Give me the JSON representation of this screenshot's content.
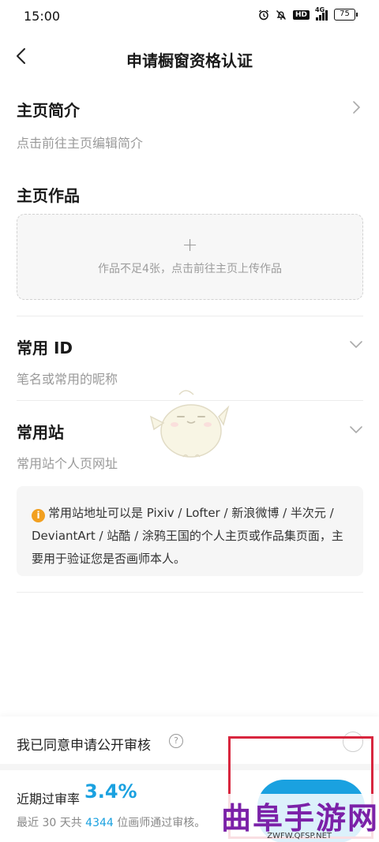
{
  "status_bar": {
    "time": "15:00",
    "hd": "HD",
    "network": "4G",
    "battery": "75"
  },
  "nav": {
    "title": "申请橱窗资格认证"
  },
  "profile_intro": {
    "title": "主页简介",
    "hint": "点击前往主页编辑简介"
  },
  "works": {
    "title": "主页作品",
    "plus": "+",
    "upload_hint": "作品不足4张，点击前往主页上传作品"
  },
  "common_id": {
    "title": "常用 ID",
    "placeholder": "笔名或常用的昵称"
  },
  "common_site": {
    "title": "常用站",
    "placeholder": "常用站个人页网址",
    "info_icon": "i",
    "info_text": "常用站地址可以是 Pixiv / Lofter / 新浪微博 / 半次元 / DeviantArt / 站酷 / 涂鸦王国的个人主页或作品集页面，主要用于验证您是否画师本人。"
  },
  "footer": {
    "agree_label": "我已同意申请公开审核",
    "help_icon": "?",
    "rate_label": "近期过审率",
    "rate_value": "3.4%",
    "stats_prefix": "最近 30 天共 ",
    "stats_count": "4344",
    "stats_suffix": " 位画师通过审核。"
  },
  "watermark": {
    "title": "曲阜手游网",
    "url": "ZWFW.QFSP.NET"
  },
  "colors": {
    "accent": "#1aa1e0",
    "info": "#f2a020",
    "highlight": "#d8263e"
  }
}
